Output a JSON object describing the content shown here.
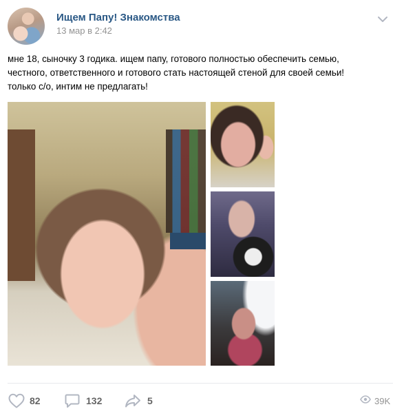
{
  "post": {
    "author": "Ищем Папу! Знакомства",
    "date": "13 мар в 2:42",
    "text_lines": [
      "мне 18, сыночку 3 годика. ищем папу, готового полностью обеспечить семью,",
      "честного, ответственного и готового стать настоящей стеной для своей семьи!",
      "только с/о, интим не предлагать!"
    ],
    "photos": [
      "main-selfie-photo",
      "thumb-photo-1",
      "thumb-photo-2",
      "thumb-photo-3"
    ]
  },
  "actions": {
    "likes": "82",
    "comments": "132",
    "shares": "5",
    "views": "39K"
  },
  "colors": {
    "author_link": "#2a5885",
    "meta_gray": "#939393",
    "action_icon": "#b2b7c2",
    "divider": "#e7e8ec"
  },
  "icons": [
    "more-icon",
    "heart-icon",
    "comment-icon",
    "share-icon",
    "eye-icon"
  ]
}
